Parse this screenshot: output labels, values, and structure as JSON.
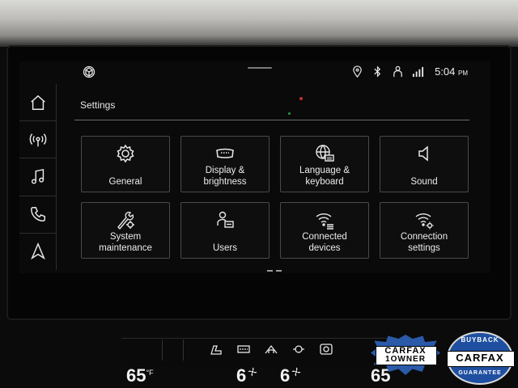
{
  "status_bar": {
    "time": "5:04",
    "ampm": "PM",
    "icons": [
      "location-heart-icon",
      "bluetooth-icon",
      "user-icon",
      "signal-icon"
    ]
  },
  "sidebar": {
    "items": [
      {
        "icon": "home-icon"
      },
      {
        "icon": "radio-icon"
      },
      {
        "icon": "music-icon"
      },
      {
        "icon": "phone-icon"
      },
      {
        "icon": "navigation-icon"
      }
    ]
  },
  "page": {
    "title": "Settings"
  },
  "tiles": [
    {
      "label": "General",
      "icon": "gear-icon"
    },
    {
      "label": "Display &\nbrightness",
      "icon": "display-icon"
    },
    {
      "label": "Language &\nkeyboard",
      "icon": "globe-keyboard-icon"
    },
    {
      "label": "Sound",
      "icon": "speaker-icon"
    },
    {
      "label": "System\nmaintenance",
      "icon": "wrench-gear-icon"
    },
    {
      "label": "Users",
      "icon": "user-card-icon"
    },
    {
      "label": "Connected\ndevices",
      "icon": "wifi-list-icon"
    },
    {
      "label": "Connection\nsettings",
      "icon": "wifi-gear-icon"
    }
  ],
  "climate": {
    "temp_left": "65",
    "temp_unit": "°F",
    "fan_left": "6",
    "fan_right": "6",
    "temp_right": "65"
  },
  "badges": {
    "carfax_owner_line1": "CARFAX",
    "carfax_owner_line2": "1OWNER",
    "carfax_guarantee_top": "BUYBACK",
    "carfax_guarantee_word": "CARFAX",
    "carfax_guarantee_bottom": "GUARANTEE"
  }
}
